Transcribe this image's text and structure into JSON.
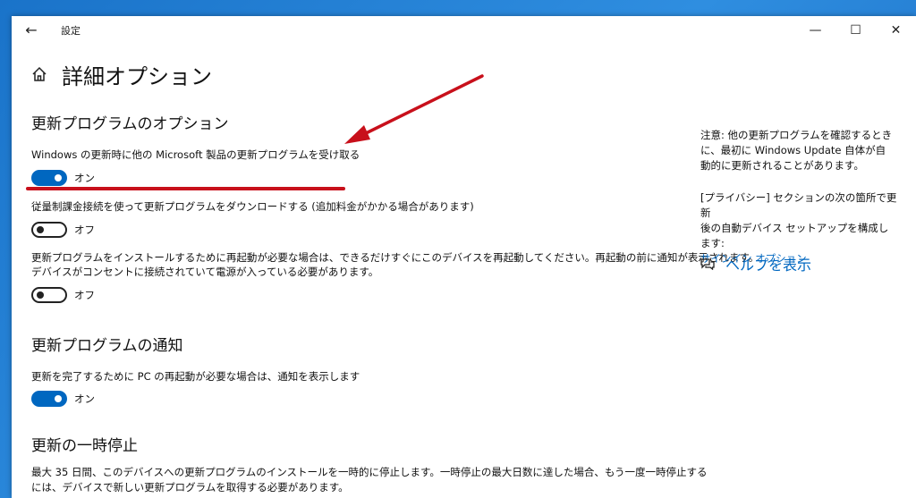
{
  "window": {
    "title": "設定",
    "controls": {
      "minimize": "—",
      "maximize": "☐",
      "close": "✕"
    }
  },
  "page": {
    "title": "詳細オプション"
  },
  "sections": {
    "update_options": {
      "title": "更新プログラムのオプション",
      "item1": {
        "label": "Windows の更新時に他の Microsoft 製品の更新プログラムを受け取る",
        "state": "オン",
        "on": true
      },
      "item2": {
        "label": "従量制課金接続を使って更新プログラムをダウンロードする (追加料金がかかる場合があります)",
        "state": "オフ",
        "on": false
      },
      "item3": {
        "label_line1": "更新プログラムをインストールするために再起動が必要な場合は、できるだけすぐにこのデバイスを再起動してください。再起動の前に通知が表示されます。",
        "label_line2": "デバイスがコンセントに接続されていて電源が入っている必要があります。",
        "state": "オフ",
        "on": false
      }
    },
    "notifications": {
      "title": "更新プログラムの通知",
      "item1": {
        "label": "更新を完了するために PC の再起動が必要な場合は、通知を表示します",
        "state": "オン",
        "on": true
      }
    },
    "pause": {
      "title": "更新の一時停止",
      "line1": "最大 35 日間、このデバイスへの更新プログラムのインストールを一時的に停止します。一時停止の最大日数に達した場合、もう一度一時停止する",
      "line2": "には、デバイスで新しい更新プログラムを取得する必要があります。"
    }
  },
  "sidebar": {
    "note_line1": "注意: 他の更新プログラムを確認するとき",
    "note_line2": "に、最初に Windows Update 自体が自",
    "note_line3": "動的に更新されることがあります。",
    "privacy_line1": "[プライバシー] セクションの次の箇所で更新",
    "privacy_line2": "後の自動デバイス セットアップを構成します:",
    "signin_link": "サインイン オプション",
    "help_link": "ヘルプを表示"
  },
  "colors": {
    "accent": "#0067c0",
    "annotation_red": "#c8101b",
    "desktop": "#2f8ee0"
  },
  "icons": {
    "back": "back-arrow-icon",
    "home": "home-icon",
    "help": "help-chat-icon"
  }
}
